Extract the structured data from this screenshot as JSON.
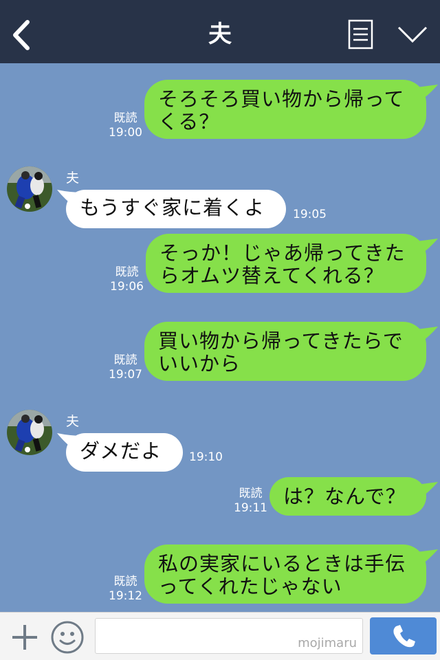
{
  "header": {
    "title": "夫",
    "back_icon": "chevron-left-icon",
    "memo_icon": "memo-icon",
    "collapse_icon": "chevron-down-icon"
  },
  "colors": {
    "header_bg": "#283348",
    "chat_bg": "#7396c4",
    "outgoing_bubble": "#86e04a",
    "incoming_bubble": "#ffffff",
    "send_button": "#4f8ad6"
  },
  "messages": [
    {
      "direction": "out",
      "lines": [
        "そろそろ買い物から帰って",
        "くる？"
      ],
      "read": "既読",
      "time": "19:00"
    },
    {
      "direction": "in",
      "sender": "夫",
      "lines": [
        "もうすぐ家に着くよ"
      ],
      "time": "19:05"
    },
    {
      "direction": "out",
      "lines": [
        "そっか！じゃあ帰ってきた",
        "らオムツ替えてくれる？"
      ],
      "read": "既読",
      "time": "19:06"
    },
    {
      "direction": "out",
      "lines": [
        "買い物から帰ってきたらで",
        "いいから"
      ],
      "read": "既読",
      "time": "19:07"
    },
    {
      "direction": "in",
      "sender": "夫",
      "lines": [
        "ダメだよ"
      ],
      "time": "19:10"
    },
    {
      "direction": "out",
      "lines": [
        "は？なんで？"
      ],
      "read": "既読",
      "time": "19:11"
    },
    {
      "direction": "out",
      "lines": [
        "私の実家にいるときは手伝",
        "ってくれたじゃない"
      ],
      "read": "既読",
      "time": "19:12"
    }
  ],
  "input": {
    "value": "",
    "watermark": "mojimaru",
    "plus_icon": "plus-icon",
    "emoji_icon": "smiley-icon",
    "send_icon": "phone-icon"
  }
}
